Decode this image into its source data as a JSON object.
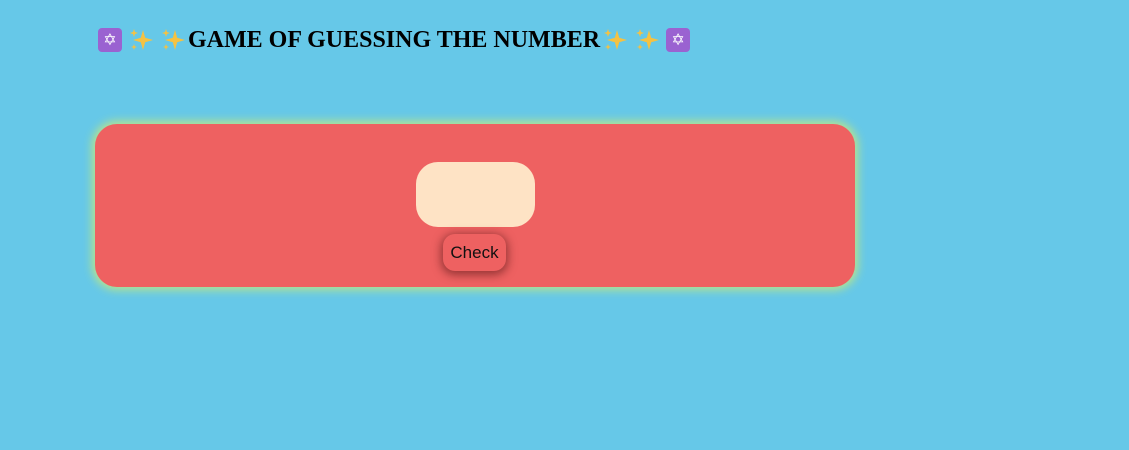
{
  "header": {
    "title": "GAME OF GUESSING THE NUMBER",
    "left_icons": [
      "six-pointed-star-icon",
      "sparkles-icon",
      "sparkles-icon"
    ],
    "right_icons": [
      "sparkles-icon",
      "sparkles-icon",
      "six-pointed-star-icon"
    ],
    "star_glyph": "✡"
  },
  "game": {
    "guess_value": "",
    "check_label": "Check"
  },
  "colors": {
    "background": "#66c8e8",
    "card": "#ee6161",
    "card_glow": "#b8e48a",
    "input": "#fee3c5",
    "star_badge": "#9a62d1",
    "sparkle": "#f5c242"
  }
}
